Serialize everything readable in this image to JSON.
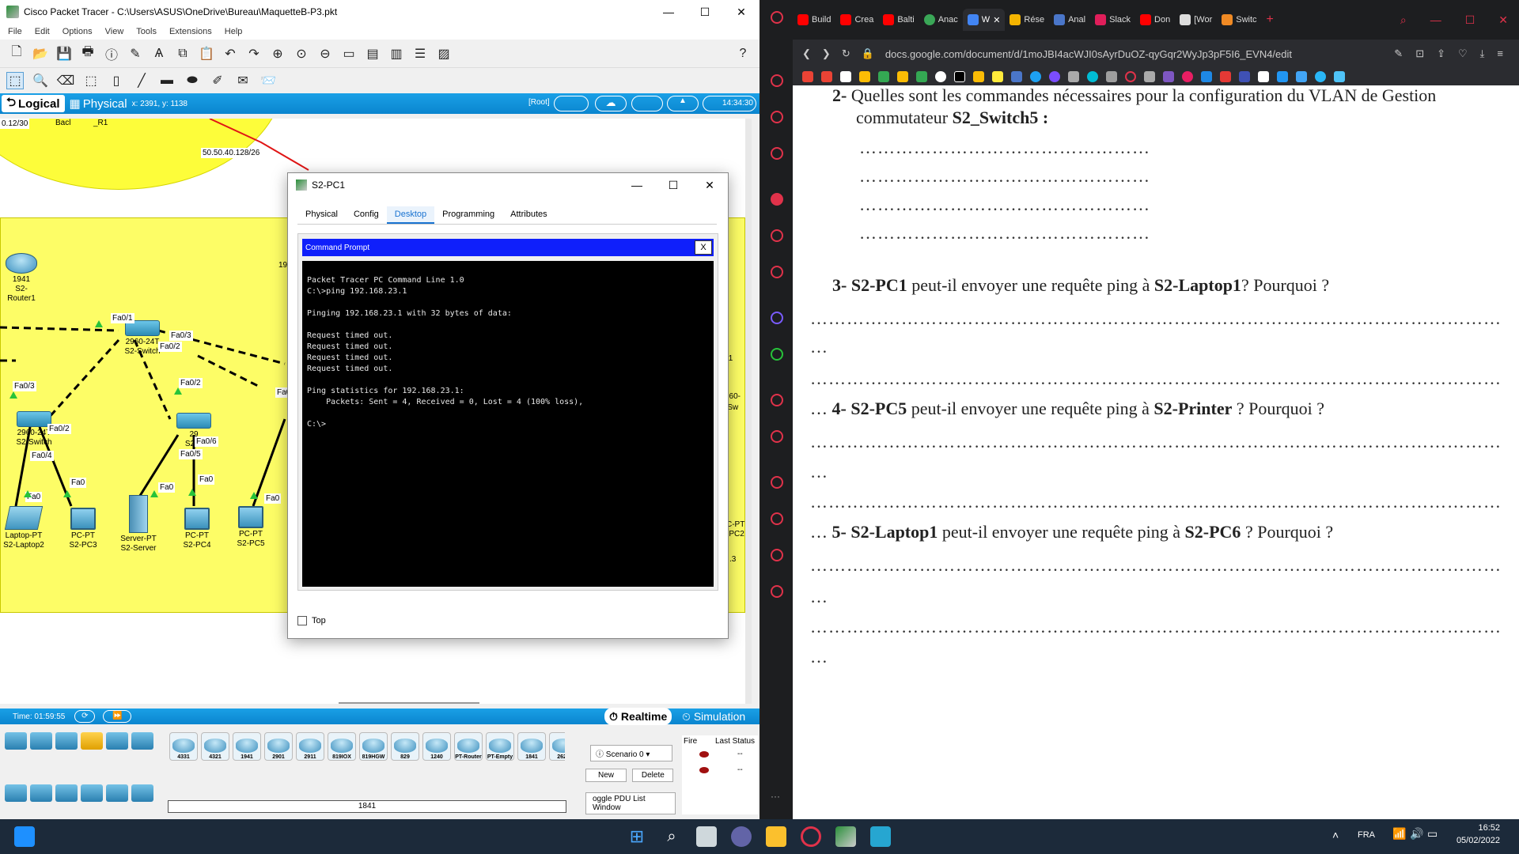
{
  "packet_tracer": {
    "title": "Cisco Packet Tracer - C:\\Users\\ASUS\\OneDrive\\Bureau\\MaquetteB-P3.pkt",
    "menu": [
      "File",
      "Edit",
      "Options",
      "View",
      "Tools",
      "Extensions",
      "Help"
    ],
    "tab_logical": "Logical",
    "tab_physical": "Physical",
    "coords": "x: 2391, y: 1138",
    "root": "[Root]",
    "clock": "14:34:30",
    "canvas": {
      "labels": [
        "50.50.40.128/26",
        "0.12/30",
        "Bacl",
        "_R1",
        "19",
        "/1",
        "960-",
        "-Sw",
        "C-PT",
        "-PC2",
        ".3"
      ],
      "devices": [
        {
          "model": "1941",
          "name": "S2-Router1"
        },
        {
          "model": "2960-24T",
          "name": "S2-Switch"
        },
        {
          "model": "2960-24T",
          "name": "S2-Switch"
        },
        {
          "model": "29",
          "name": "S2-S"
        },
        {
          "model": "Laptop-PT",
          "name": "S2-Laptop2"
        },
        {
          "model": "PC-PT",
          "name": "S2-PC3"
        },
        {
          "model": "Server-PT",
          "name": "S2-Server"
        },
        {
          "model": "PC-PT",
          "name": "S2-PC4"
        },
        {
          "model": "PC-PT",
          "name": "S2-PC5"
        }
      ],
      "ports": [
        "Fa0/1",
        "Fa0/3",
        "Fa0/2",
        "Fa0/2",
        "Fa0/3",
        "Fa0/2",
        "Fa0/4",
        "Fa0/6",
        "Fa0/5",
        "Fa0",
        "Fa0",
        "Fa0",
        "Fa0",
        "Fa0",
        "Fa0"
      ]
    },
    "dialog": {
      "title": "S2-PC1",
      "tabs": [
        "Physical",
        "Config",
        "Desktop",
        "Programming",
        "Attributes"
      ],
      "active_tab": "Desktop",
      "cmd_title": "Command Prompt",
      "cmd_close": "X",
      "console": "Packet Tracer PC Command Line 1.0\nC:\\>ping 192.168.23.1\n\nPinging 192.168.23.1 with 32 bytes of data:\n\nRequest timed out.\nRequest timed out.\nRequest timed out.\nRequest timed out.\n\nPing statistics for 192.168.23.1:\n    Packets: Sent = 4, Received = 0, Lost = 4 (100% loss),\n\nC:\\>",
      "top_label": "Top"
    },
    "bottom": {
      "time": "Time: 01:59:55",
      "realtime": "Realtime",
      "simulation": "Simulation",
      "models": [
        "4331",
        "4321",
        "1941",
        "2901",
        "2911",
        "819IOX",
        "819HGW",
        "829",
        "1240",
        "PT-Router",
        "PT-Empty",
        "1841",
        "2620"
      ],
      "selected_model": "1841",
      "scenario": "Scenario 0",
      "new_btn": "New",
      "delete_btn": "Delete",
      "pdu_btn": "oggle PDU List Window",
      "fire_header": "Fire",
      "last_status_header": "Last Status",
      "rows": [
        "--",
        "--"
      ]
    }
  },
  "browser": {
    "tabs": [
      "Build",
      "Crea",
      "Balti",
      "Anac",
      "W",
      "Rése",
      "Anal",
      "Slack",
      "Don",
      "[Wor",
      "Switc"
    ],
    "url": "docs.google.com/document/d/1moJBI4acWJI0sAyrDuOZ-qyGqr2WyJp3pF5I6_EVN4/edit",
    "doc": {
      "q2_num": "2-",
      "q2_text": " Quelles sont les commandes nécessaires pour la configuration du VLAN de Gestion",
      "q2_line2": "commutateur ",
      "q2_bold": "S2_Switch5 :",
      "dots_short": "…………………………………………",
      "q3_num": "3-",
      "q3_b1": "S2-PC1",
      "q3_t1": " peut-il envoyer une requête ping à ",
      "q3_b2": "S2-Laptop1",
      "q3_t2": "? Pourquoi ?",
      "dots_long": "……………………………………………………………………………………………………",
      "ellipsis": "…",
      "q4_num": "4-",
      "q4_b1": "S2-PC5",
      "q4_t1": " peut-il envoyer une requête ping à ",
      "q4_b2": "S2-Printer",
      "q4_t2": " ? Pourquoi ?",
      "q5_num": "5-",
      "q5_b1": "S2-Laptop1",
      "q5_t1": " peut-il envoyer une requête ping à ",
      "q5_b2": "S2-PC6",
      "q5_t2": " ? Pourquoi ?"
    }
  },
  "taskbar": {
    "lang": "FRA",
    "time": "16:52",
    "date": "05/02/2022"
  },
  "colors": {
    "pt_blue": "#0a85cf",
    "cmd_bar": "#0f1ffb",
    "yellow_zone": "#fdfd66",
    "opera_red": "#e0324a"
  }
}
